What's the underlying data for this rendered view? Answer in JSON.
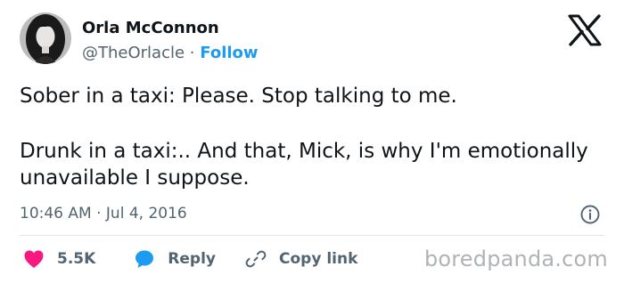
{
  "author": {
    "display_name": "Orla McConnon",
    "handle": "@TheOrlacle",
    "separator": "·",
    "follow_label": "Follow",
    "avatar_icon": "profile-photo"
  },
  "brand_icon": "x-logo-icon",
  "tweet": {
    "paragraphs": [
      "Sober in a taxi: Please. Stop talking to me.",
      "Drunk in a taxi:.. And that, Mick, is why I'm emotionally unavailable I suppose."
    ],
    "timestamp": "10:46 AM · Jul 4, 2016"
  },
  "actions": {
    "like": {
      "count": "5.5K",
      "icon": "heart-icon",
      "color": "#f91880"
    },
    "reply": {
      "label": "Reply",
      "icon": "speech-bubble-icon",
      "color": "#1d9bf0"
    },
    "copy_link": {
      "label": "Copy link",
      "icon": "link-icon"
    }
  },
  "watermark": "boredpanda.com",
  "colors": {
    "text": "#0f1419",
    "secondary": "#536471",
    "accent": "#1d9bf0",
    "like": "#f91880",
    "divider": "#dfe4e8"
  }
}
